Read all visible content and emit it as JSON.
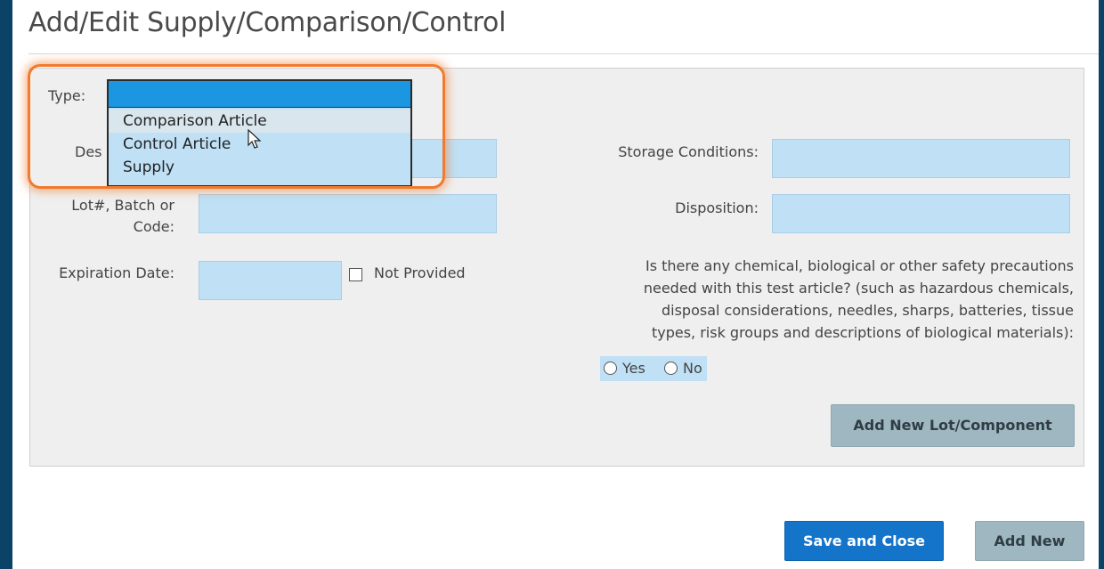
{
  "page": {
    "title": "Add/Edit Supply/Comparison/Control"
  },
  "form": {
    "type_label": "Type:",
    "type_value": "",
    "type_options": [
      "Comparison Article",
      "Control Article",
      "Supply"
    ],
    "description_label_partial": "Des",
    "lot_label_line1": "Lot#, Batch or",
    "lot_label_line2": "Code:",
    "expiration_label": "Expiration Date:",
    "not_provided_label": "Not Provided",
    "storage_label": "Storage Conditions:",
    "disposition_label": "Disposition:",
    "safety_question": [
      "Is there any chemical, biological or other safety precautions",
      "needed with this test article? (such as hazardous chemicals,",
      "disposal considerations, needles, sharps, batteries, tissue",
      "types, risk groups and descriptions of biological materials):"
    ],
    "yes_label": "Yes",
    "no_label": "No"
  },
  "buttons": {
    "add_lot": "Add New Lot/Component",
    "save_close": "Save and Close",
    "add_new": "Add New"
  },
  "colors": {
    "background": "#0b4268",
    "field": "#bfe0f5",
    "highlight": "#f07a2d",
    "primary_button": "#1474c9",
    "secondary_button": "#9fb7c1"
  }
}
